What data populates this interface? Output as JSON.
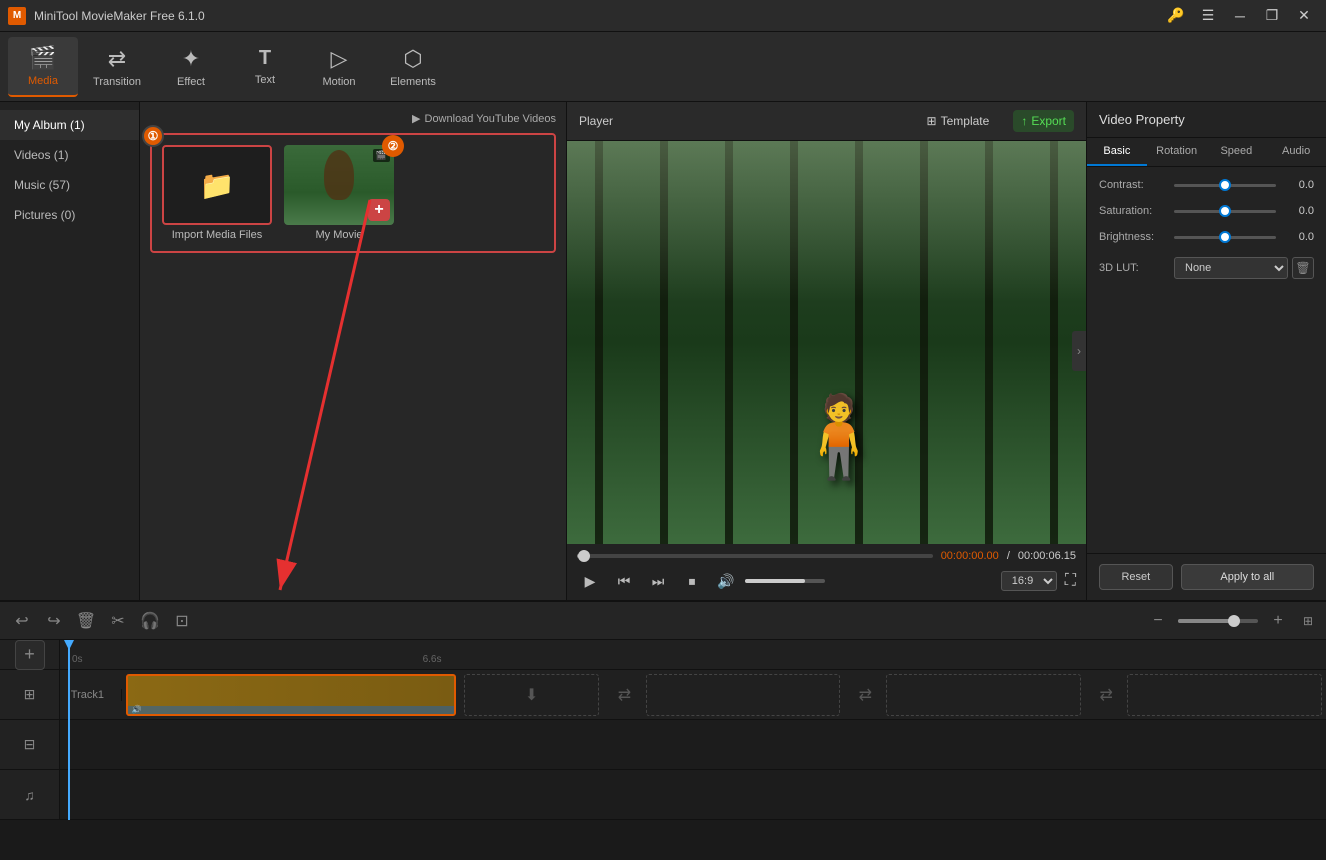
{
  "app": {
    "title": "MiniTool MovieMaker Free 6.1.0"
  },
  "titlebar": {
    "title": "MiniTool MovieMaker Free 6.1.0",
    "minimize_label": "─",
    "restore_label": "❐",
    "close_label": "✕"
  },
  "toolbar": {
    "items": [
      {
        "id": "media",
        "label": "Media",
        "icon": "🎬",
        "active": true
      },
      {
        "id": "transition",
        "label": "Transition",
        "icon": "⇄",
        "active": false
      },
      {
        "id": "effect",
        "label": "Effect",
        "icon": "✨",
        "active": false
      },
      {
        "id": "text",
        "label": "Text",
        "icon": "T",
        "active": false
      },
      {
        "id": "motion",
        "label": "Motion",
        "icon": "▶",
        "active": false
      },
      {
        "id": "elements",
        "label": "Elements",
        "icon": "⬡",
        "active": false
      }
    ]
  },
  "sidebar": {
    "items": [
      {
        "label": "My Album (1)",
        "active": true,
        "badge": "1"
      },
      {
        "label": "Videos (1)",
        "active": false
      },
      {
        "label": "Music (57)",
        "active": false
      },
      {
        "label": "Pictures (0)",
        "active": false
      }
    ]
  },
  "media_panel": {
    "download_yt_label": "Download YouTube Videos",
    "import_label": "Import Media Files",
    "video_label": "My Movie"
  },
  "player": {
    "title": "Player",
    "template_label": "Template",
    "export_label": "Export",
    "time_current": "00:00:00.00",
    "time_separator": " / ",
    "time_total": "00:00:06.15",
    "aspect_ratio": "16:9",
    "volume": 75
  },
  "video_property": {
    "title": "Video Property",
    "tabs": [
      "Basic",
      "Rotation",
      "Speed",
      "Audio"
    ],
    "active_tab": "Basic",
    "contrast_label": "Contrast:",
    "contrast_value": "0.0",
    "saturation_label": "Saturation:",
    "saturation_value": "0.0",
    "brightness_label": "Brightness:",
    "brightness_value": "0.0",
    "lut_label": "3D LUT:",
    "lut_value": "None",
    "reset_label": "Reset",
    "apply_all_label": "Apply to all"
  },
  "timeline": {
    "tracks": [
      {
        "id": "track1",
        "label": "Track1"
      },
      {
        "id": "track2",
        "label": "⊞",
        "icon": true
      },
      {
        "id": "music",
        "label": "♫",
        "icon": true
      }
    ],
    "duration_marker": "6.6s",
    "zoom_level": 70
  },
  "annotations": {
    "badge1": "①",
    "badge2": "②"
  }
}
